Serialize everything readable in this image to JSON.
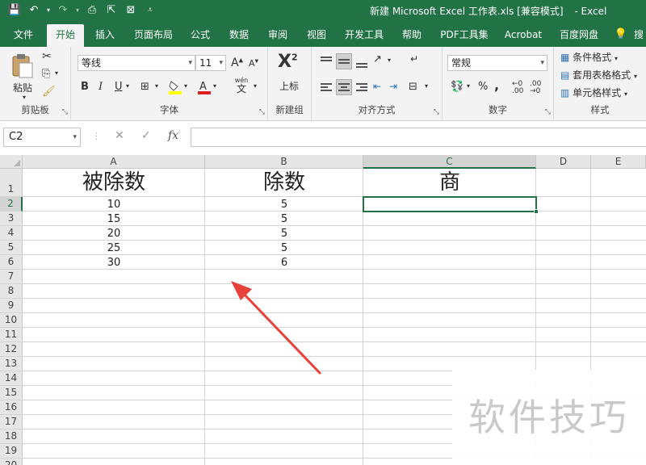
{
  "window": {
    "title": "新建 Microsoft Excel 工作表.xls [兼容模式]",
    "app": "Excel"
  },
  "qat": {
    "save_icon": "save-icon",
    "undo_icon": "undo-icon",
    "redo_icon": "redo-icon",
    "preview_icon": "print-preview-icon",
    "send_icon": "send-icon",
    "clear_icon": "clear-format-icon",
    "customize_icon": "customize-icon"
  },
  "tabs": [
    "文件",
    "开始",
    "插入",
    "页面布局",
    "公式",
    "数据",
    "审阅",
    "视图",
    "开发工具",
    "帮助",
    "PDF工具集",
    "Acrobat",
    "百度网盘",
    "搜"
  ],
  "active_tab": "开始",
  "ribbon": {
    "clipboard": {
      "paste": "粘贴",
      "label": "剪贴板"
    },
    "font": {
      "name": "等线",
      "size": "11",
      "label": "字体",
      "bold": "B",
      "italic": "I",
      "underline": "U",
      "grow": "A",
      "shrink": "A",
      "wen": "wén",
      "wen_char": "文"
    },
    "new_group": {
      "superscript": "上标",
      "label": "新建组"
    },
    "alignment": {
      "label": "对齐方式"
    },
    "number": {
      "format": "常规",
      "label": "数字",
      "percent": "%",
      "comma": ","
    },
    "styles": {
      "conditional": "条件格式",
      "table": "套用表格格式",
      "cell": "单元格样式",
      "label": "样式"
    }
  },
  "formula_bar": {
    "name_box": "C2",
    "cancel": "✕",
    "enter": "✓",
    "fx": "fx",
    "value": ""
  },
  "sheet": {
    "columns": [
      "A",
      "B",
      "C",
      "D",
      "E"
    ],
    "selected_column": "C",
    "rows": [
      "1",
      "2",
      "3",
      "4",
      "5",
      "6",
      "7",
      "8",
      "9",
      "10",
      "11",
      "12",
      "13",
      "14",
      "15",
      "16",
      "17",
      "18",
      "19",
      "20"
    ],
    "selected_row": "2",
    "headers": {
      "A": "被除数",
      "B": "除数",
      "C": "商"
    },
    "data": [
      {
        "A": "10",
        "B": "5"
      },
      {
        "A": "15",
        "B": "5"
      },
      {
        "A": "20",
        "B": "5"
      },
      {
        "A": "25",
        "B": "5"
      },
      {
        "A": "30",
        "B": "6"
      }
    ]
  },
  "watermark": "软件技巧",
  "colors": {
    "brand": "#217346",
    "arrow": "#e8403a"
  }
}
